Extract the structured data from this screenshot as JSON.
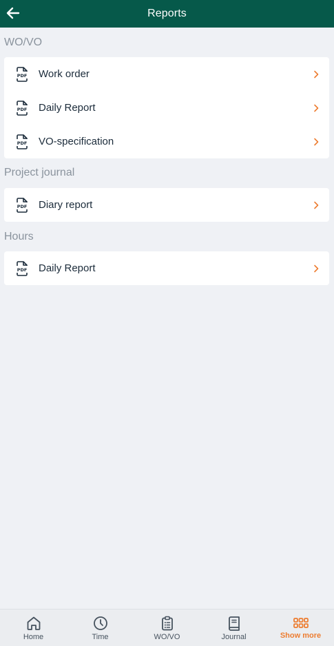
{
  "header": {
    "title": "Reports",
    "back_icon": "arrow-left-icon"
  },
  "sections": [
    {
      "title": "WO/VO",
      "items": [
        "Work order",
        "Daily Report",
        "VO-specification"
      ]
    },
    {
      "title": "Project journal",
      "items": [
        "Diary report"
      ]
    },
    {
      "title": "Hours",
      "items": [
        "Daily Report"
      ]
    }
  ],
  "nav": [
    {
      "label": "Home",
      "icon": "home-icon",
      "active": false
    },
    {
      "label": "Time",
      "icon": "clock-icon",
      "active": false
    },
    {
      "label": "WO/VO",
      "icon": "clipboard-icon",
      "active": false
    },
    {
      "label": "Journal",
      "icon": "book-icon",
      "active": false
    },
    {
      "label": "Show more",
      "icon": "grid-icon",
      "active": true
    }
  ],
  "colors": {
    "header_bg": "#06594a",
    "accent": "#ed7d31",
    "background": "#eff1f5"
  }
}
